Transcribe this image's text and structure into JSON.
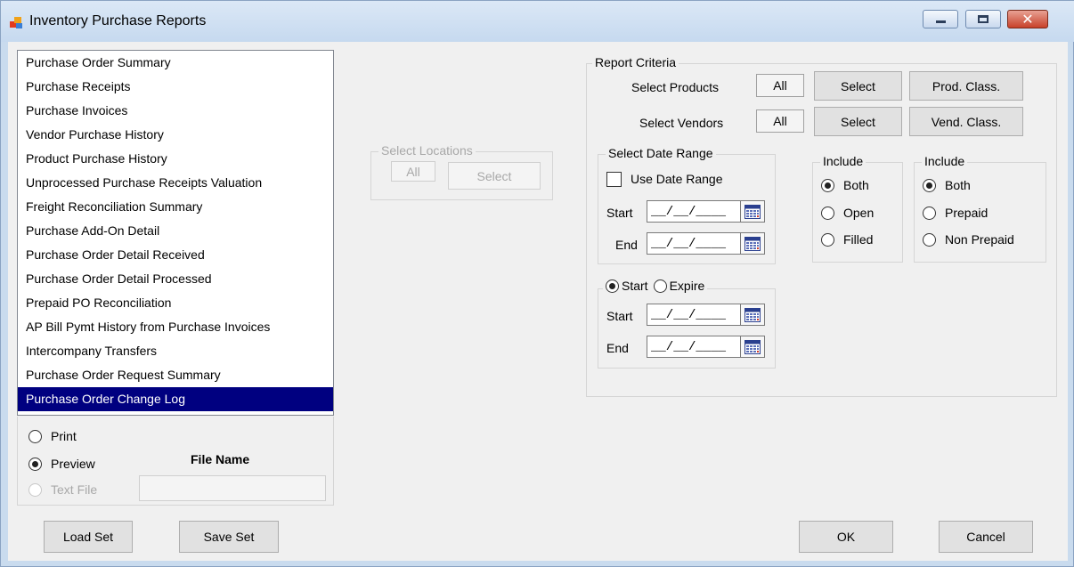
{
  "window": {
    "title": "Inventory Purchase Reports",
    "close_glyph": "✕"
  },
  "reports": [
    "Purchase Order Summary",
    "Purchase Receipts",
    "Purchase Invoices",
    "Vendor Purchase History",
    "Product Purchase History",
    "Unprocessed Purchase Receipts Valuation",
    "Freight Reconciliation Summary",
    "Purchase Add-On Detail",
    "Purchase Order Detail Received",
    "Purchase Order Detail Processed",
    "Prepaid PO Reconciliation",
    "AP Bill Pymt History from Purchase Invoices",
    "Intercompany Transfers",
    "Purchase Order Request Summary",
    "Purchase Order Change Log"
  ],
  "selected_report": "Purchase Order Change Log",
  "output": {
    "print": "Print",
    "preview": "Preview",
    "text_file": "Text File",
    "file_name_label": "File Name",
    "selected": "Preview"
  },
  "locations": {
    "legend": "Select Locations",
    "all": "All",
    "select": "Select"
  },
  "criteria": {
    "legend": "Report Criteria",
    "select_products_label": "Select Products",
    "products_value": "All",
    "select_button": "Select",
    "prod_class_button": "Prod. Class.",
    "select_vendors_label": "Select Vendors",
    "vendors_value": "All",
    "vend_class_button": "Vend. Class."
  },
  "date_range": {
    "legend": "Select Date Range",
    "use_date_range": "Use Date Range",
    "use_date_range_checked": false,
    "start_label": "Start",
    "end_label": "End",
    "start_value": "__/__/____",
    "end_value": "__/__/____"
  },
  "start_expire": {
    "start_option": "Start",
    "expire_option": "Expire",
    "selected": "Start",
    "start_label": "Start",
    "end_label": "End",
    "start_value": "__/__/____",
    "end_value": "__/__/____"
  },
  "include_status": {
    "legend": "Include",
    "options": [
      "Both",
      "Open",
      "Filled"
    ],
    "selected": "Both"
  },
  "include_prepaid": {
    "legend": "Include",
    "options": [
      "Both",
      "Prepaid",
      "Non Prepaid"
    ],
    "selected": "Both"
  },
  "buttons": {
    "load_set": "Load Set",
    "save_set": "Save Set",
    "ok": "OK",
    "cancel": "Cancel"
  },
  "colors": {
    "selection_bg": "#000080",
    "window_frame": "#c9dbee",
    "client_bg": "#f0f0f0"
  }
}
